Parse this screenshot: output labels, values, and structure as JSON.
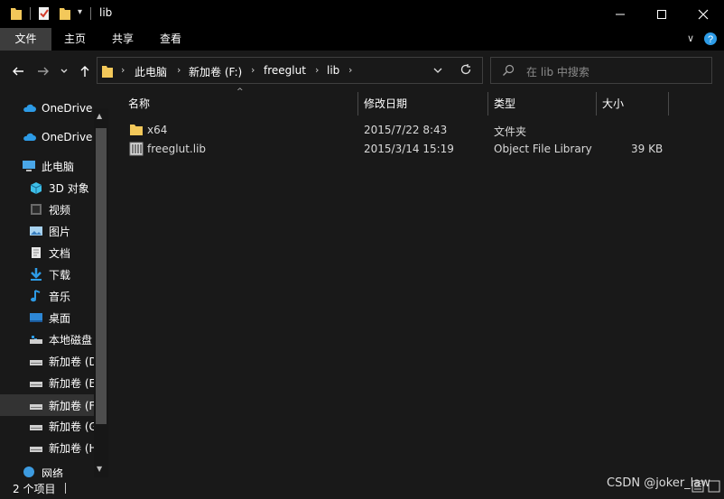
{
  "window": {
    "title": "lib"
  },
  "ribbon": {
    "tabs": [
      "文件",
      "主页",
      "共享",
      "查看"
    ]
  },
  "address": {
    "crumbs": [
      "此电脑",
      "新加卷 (F:)",
      "freeglut",
      "lib"
    ]
  },
  "search": {
    "placeholder": "在 lib 中搜索"
  },
  "sidebar": {
    "items": [
      {
        "label": "OneDrive",
        "icon": "cloud-icon"
      },
      {
        "label": "OneDrive",
        "icon": "cloud-icon"
      },
      {
        "label": "此电脑",
        "icon": "computer-icon"
      },
      {
        "label": "3D 对象",
        "icon": "cube-icon"
      },
      {
        "label": "视频",
        "icon": "video-icon"
      },
      {
        "label": "图片",
        "icon": "picture-icon"
      },
      {
        "label": "文档",
        "icon": "document-icon"
      },
      {
        "label": "下载",
        "icon": "download-icon"
      },
      {
        "label": "音乐",
        "icon": "music-icon"
      },
      {
        "label": "桌面",
        "icon": "desktop-icon"
      },
      {
        "label": "本地磁盘",
        "icon": "drive-icon"
      },
      {
        "label": "新加卷 (D",
        "icon": "drive-icon"
      },
      {
        "label": "新加卷 (E",
        "icon": "drive-icon"
      },
      {
        "label": "新加卷 (F",
        "icon": "drive-icon"
      },
      {
        "label": "新加卷 (G",
        "icon": "drive-icon"
      },
      {
        "label": "新加卷 (H",
        "icon": "drive-icon"
      },
      {
        "label": "网络",
        "icon": "network-icon"
      }
    ]
  },
  "columns": {
    "name": "名称",
    "date": "修改日期",
    "type": "类型",
    "size": "大小"
  },
  "files": [
    {
      "name": "x64",
      "date": "2015/7/22 8:43",
      "type": "文件夹",
      "size": "",
      "icon": "folder-icon"
    },
    {
      "name": "freeglut.lib",
      "date": "2015/3/14 15:19",
      "type": "Object File Library",
      "size": "39 KB",
      "icon": "library-file-icon"
    }
  ],
  "status": {
    "count": "2 个项目"
  },
  "watermark": "CSDN @joker_law",
  "colors": {
    "background": "#191919",
    "chrome": "#000000",
    "active_tab": "#3d3d3d",
    "folder": "#f3c85a",
    "accent_blue": "#2d9be6"
  }
}
